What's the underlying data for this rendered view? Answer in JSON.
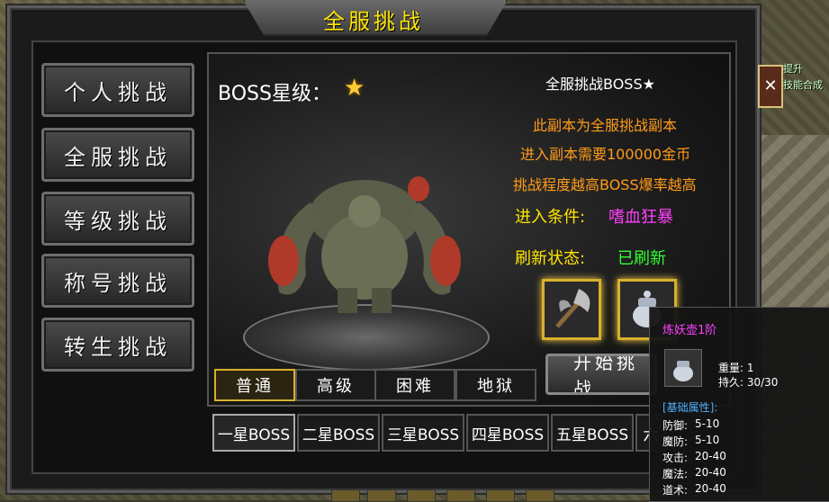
{
  "window": {
    "title": "全服挑战"
  },
  "nav": [
    {
      "label": "个人挑战"
    },
    {
      "label": "全服挑战"
    },
    {
      "label": "等级挑战"
    },
    {
      "label": "称号挑战"
    },
    {
      "label": "转生挑战"
    }
  ],
  "boss": {
    "star_label": "BOSS星级：",
    "star_icon": "star-icon"
  },
  "info": {
    "title": "全服挑战BOSS★",
    "lines": [
      "此副本为全服挑战副本",
      "进入副本需要100000金币",
      "挑战程度越高BOSS爆率越高"
    ],
    "condition_label": "进入条件:",
    "condition_value": "嗜血狂暴",
    "refresh_label": "刷新状态:",
    "refresh_value": "已刷新"
  },
  "difficulty": [
    {
      "label": "普通"
    },
    {
      "label": "高级"
    },
    {
      "label": "困难"
    },
    {
      "label": "地狱"
    }
  ],
  "start_button": "开始挑战",
  "tiers": [
    {
      "label": "一星BOSS"
    },
    {
      "label": "二星BOSS"
    },
    {
      "label": "三星BOSS"
    },
    {
      "label": "四星BOSS"
    },
    {
      "label": "五星BOSS"
    },
    {
      "label": "六"
    }
  ],
  "side": {
    "top_label": "提升",
    "bottom_label": "技能合成",
    "close_icon": "close-icon"
  },
  "tooltip": {
    "name": "炼妖壶1阶",
    "weight": "重量:  1",
    "durability": "持久:  30/30",
    "attr_header": "[基础属性]:",
    "attrs": [
      {
        "label": "防御:",
        "value": "5-10"
      },
      {
        "label": "魔防:",
        "value": "5-10"
      },
      {
        "label": "攻击:",
        "value": "20-40"
      },
      {
        "label": "魔法:",
        "value": "20-40"
      },
      {
        "label": "道术:",
        "value": "20-40"
      }
    ]
  },
  "colors": {
    "title": "#ffe600",
    "info": "#ff9b1a",
    "condition_value": "#ff40ff",
    "refresh_value": "#33ff33",
    "tooltip_name": "#ff40ff",
    "tooltip_header": "#4fb0ff"
  }
}
